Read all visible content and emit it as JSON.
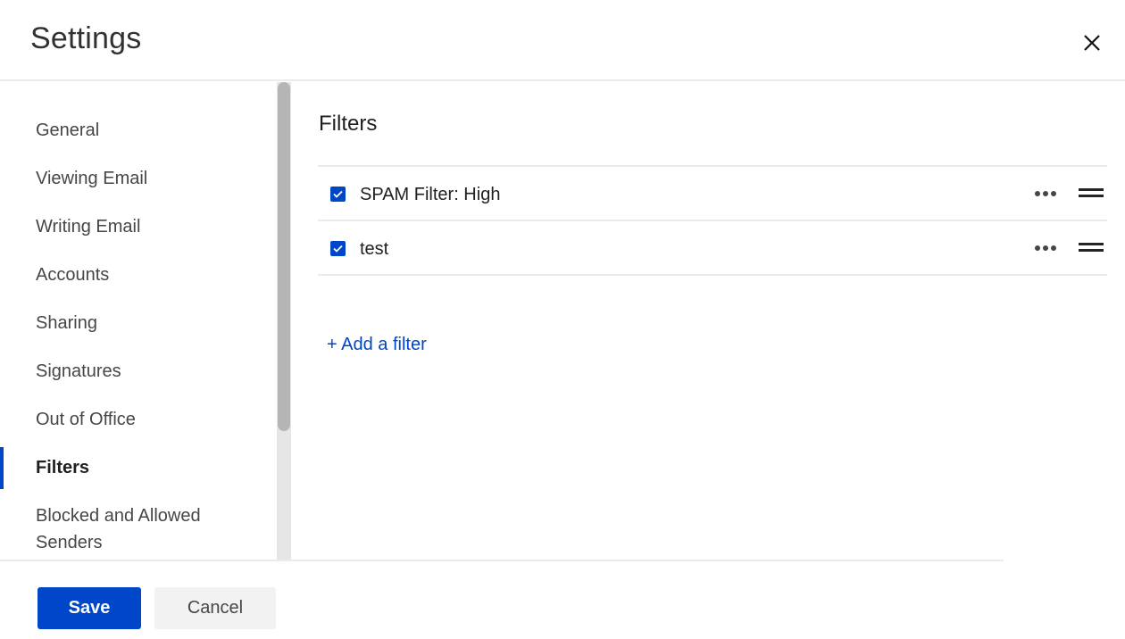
{
  "header": {
    "title": "Settings",
    "close_icon": "close-icon"
  },
  "sidebar": {
    "items": [
      {
        "label": "General",
        "active": false
      },
      {
        "label": "Viewing Email",
        "active": false
      },
      {
        "label": "Writing Email",
        "active": false
      },
      {
        "label": "Accounts",
        "active": false
      },
      {
        "label": "Sharing",
        "active": false
      },
      {
        "label": "Signatures",
        "active": false
      },
      {
        "label": "Out of Office",
        "active": false
      },
      {
        "label": "Filters",
        "active": true
      },
      {
        "label": "Blocked and Allowed Senders",
        "active": false
      }
    ]
  },
  "main": {
    "title": "Filters",
    "filters": [
      {
        "name": "SPAM Filter: High",
        "enabled": true
      },
      {
        "name": "test",
        "enabled": true
      }
    ],
    "add_filter_label": "+ Add a filter"
  },
  "footer": {
    "save_label": "Save",
    "cancel_label": "Cancel"
  },
  "colors": {
    "accent": "#0046c8",
    "divider": "#ebebeb",
    "scroll_thumb": "#b5b5b5",
    "scroll_track": "#e6e6e6"
  }
}
